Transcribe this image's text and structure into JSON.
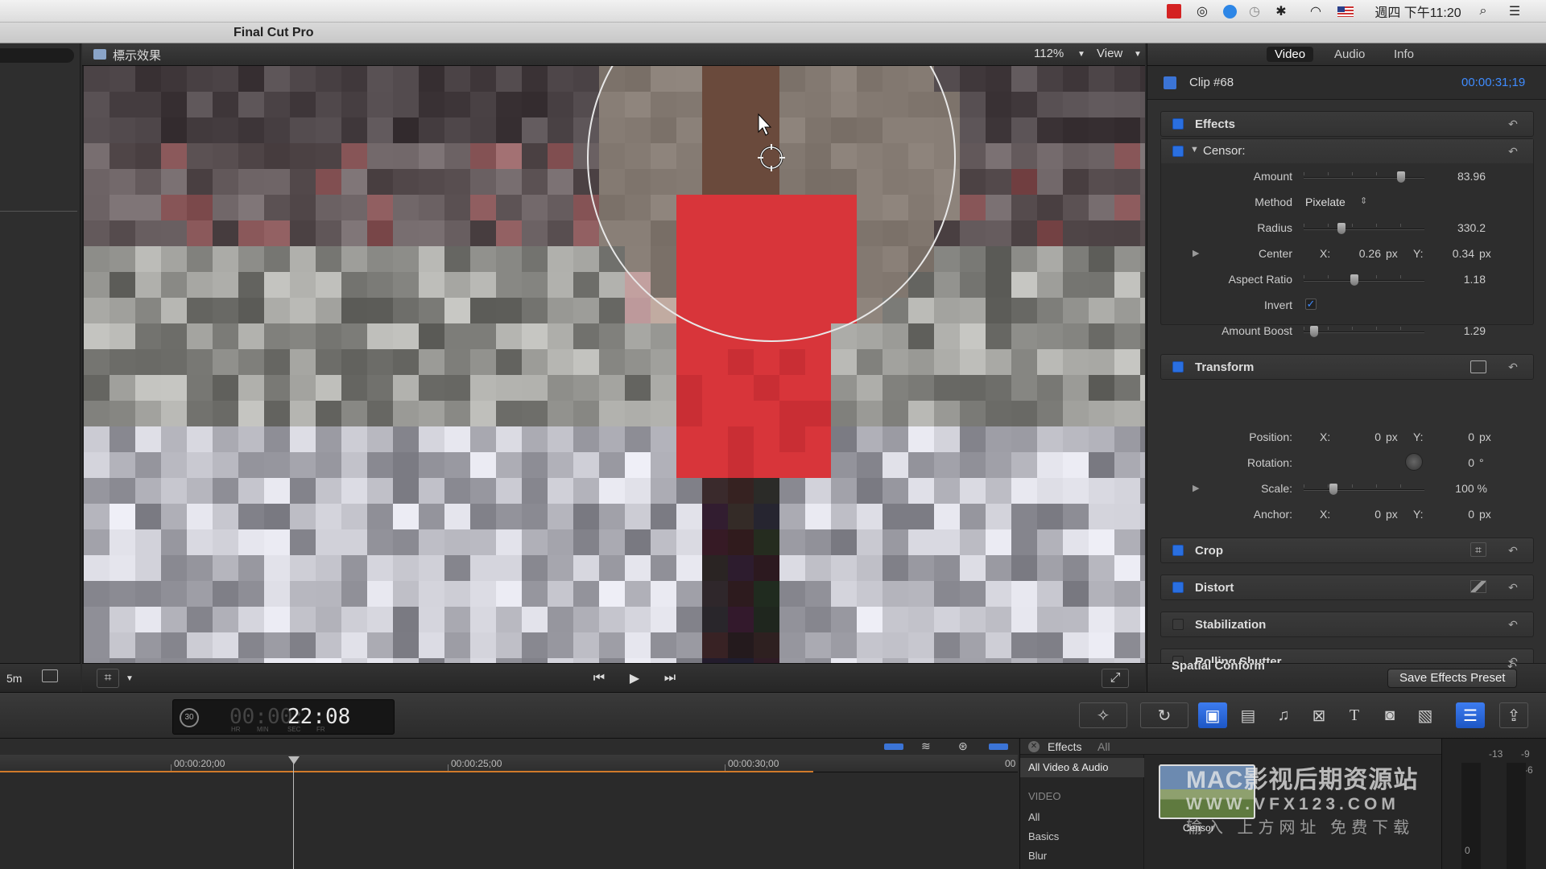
{
  "menubar": {
    "clock": "週四 下午11:20"
  },
  "app": {
    "title": "Final Cut Pro"
  },
  "viewer": {
    "clip_title": "標示效果",
    "zoom": "112%",
    "view_label": "View"
  },
  "inspector": {
    "tabs": [
      "Video",
      "Audio",
      "Info"
    ],
    "clip_name": "Clip #68",
    "clip_time": "00:00:31;19",
    "effects_label": "Effects",
    "censor": {
      "name": "Censor:",
      "amount_label": "Amount",
      "amount_value": "83.96",
      "amount": 83.96,
      "method_label": "Method",
      "method_value": "Pixelate",
      "radius_label": "Radius",
      "radius_value": "330.2",
      "center_label": "Center",
      "center_x_label": "X:",
      "center_x": "0.26",
      "center_y_label": "Y:",
      "center_y": "0.34",
      "unit_px": "px",
      "aspect_label": "Aspect Ratio",
      "aspect_value": "1.18",
      "invert_label": "Invert",
      "boost_label": "Amount Boost",
      "boost_value": "1.29"
    },
    "transform": {
      "label": "Transform",
      "position_label": "Position:",
      "pos_x": "0",
      "pos_y": "0",
      "rotation_label": "Rotation:",
      "rotation_value": "0",
      "degree": "°",
      "scale_label": "Scale:",
      "scale_value": "100 %",
      "anchor_label": "Anchor:",
      "anchor_x": "0",
      "anchor_y": "0",
      "x_label": "X:",
      "y_label": "Y:",
      "unit_px": "px"
    },
    "crop_label": "Crop",
    "distort_label": "Distort",
    "stabilization_label": "Stabilization",
    "rolling_shutter_label": "Rolling Shutter",
    "spatial_conform_label": "Spatial Conform",
    "save_preset_label": "Save Effects Preset"
  },
  "left": {
    "zoom_label": "5m"
  },
  "toolbar": {
    "fps": "30",
    "tc_dim": "00:00:",
    "tc_main": "22:08",
    "tc_units": [
      "HR",
      "MIN",
      "SEC",
      "FR"
    ]
  },
  "timeline": {
    "marks": [
      "00:00:20;00",
      "00:00:25;00",
      "00:00:30;00",
      "00"
    ]
  },
  "effects_browser": {
    "title": "Effects",
    "filter": "All",
    "categories": [
      "All Video & Audio"
    ],
    "section_label": "VIDEO",
    "items": [
      "All",
      "Basics",
      "Blur"
    ],
    "thumb_label": "Censor"
  },
  "watermark": {
    "line1": "MAC影视后期资源站",
    "line2": "WWW.VFX123.COM",
    "line3": "输入 上方网址  免费下载"
  },
  "meters": {
    "labels": [
      "-13",
      "-9",
      "-6",
      "0"
    ]
  },
  "colors": {
    "accent_blue": "#2a6fe0",
    "time_blue": "#3f8cff",
    "hood_red": "#d8353a"
  }
}
